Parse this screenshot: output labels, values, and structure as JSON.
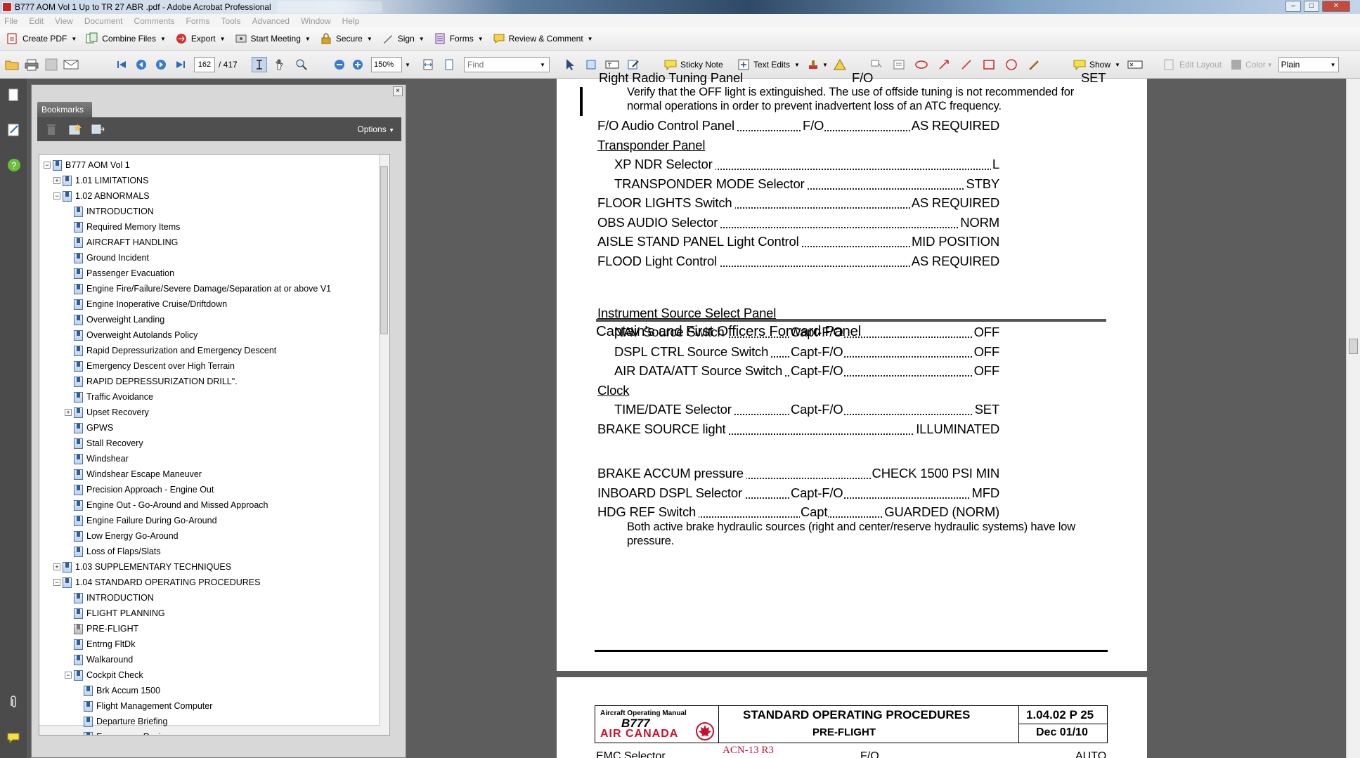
{
  "window": {
    "title": "B777 AOM Vol 1 Up to TR 27  ABR .pdf - Adobe Acrobat Professional"
  },
  "menu": [
    "File",
    "Edit",
    "View",
    "Document",
    "Comments",
    "Forms",
    "Tools",
    "Advanced",
    "Window",
    "Help"
  ],
  "toolbar1": {
    "create_pdf": "Create PDF",
    "combine_files": "Combine Files",
    "export": "Export",
    "start_meeting": "Start Meeting",
    "secure": "Secure",
    "sign": "Sign",
    "forms": "Forms",
    "review_comment": "Review & Comment"
  },
  "toolbar2": {
    "page_current": "162",
    "page_total": "/ 417",
    "zoom": "150%",
    "find_placeholder": "Find",
    "sticky_note": "Sticky Note",
    "text_edits": "Text Edits",
    "show": "Show",
    "edit_layout": "Edit Layout",
    "color": "Color",
    "plain": "Plain"
  },
  "bookmarks": {
    "tab_label": "Bookmarks",
    "options_label": "Options",
    "items": [
      {
        "label": "B777 AOM Vol 1",
        "level": 0,
        "exp": "minus"
      },
      {
        "label": "1.01 LIMITATIONS",
        "level": 1,
        "exp": "plus"
      },
      {
        "label": "1.02 ABNORMALS",
        "level": 1,
        "exp": "minus"
      },
      {
        "label": "INTRODUCTION",
        "level": 2,
        "exp": ""
      },
      {
        "label": "Required Memory Items",
        "level": 2,
        "exp": ""
      },
      {
        "label": "AIRCRAFT HANDLING",
        "level": 2,
        "exp": ""
      },
      {
        "label": "Ground Incident",
        "level": 2,
        "exp": ""
      },
      {
        "label": "Passenger Evacuation",
        "level": 2,
        "exp": ""
      },
      {
        "label": "Engine Fire/Failure/Severe Damage/Separation at or above V1",
        "level": 2,
        "exp": ""
      },
      {
        "label": "Engine Inoperative Cruise/Driftdown",
        "level": 2,
        "exp": ""
      },
      {
        "label": "Overweight Landing",
        "level": 2,
        "exp": ""
      },
      {
        "label": "Overweight Autolands Policy",
        "level": 2,
        "exp": ""
      },
      {
        "label": "Rapid Depressurization and Emergency Descent",
        "level": 2,
        "exp": ""
      },
      {
        "label": "Emergency Descent over High Terrain",
        "level": 2,
        "exp": ""
      },
      {
        "label": "RAPID DEPRESSURIZATION DRILL\".",
        "level": 2,
        "exp": ""
      },
      {
        "label": "Traffic Avoidance",
        "level": 2,
        "exp": ""
      },
      {
        "label": "Upset Recovery",
        "level": 2,
        "exp": "plus"
      },
      {
        "label": "GPWS",
        "level": 2,
        "exp": ""
      },
      {
        "label": "Stall Recovery",
        "level": 2,
        "exp": ""
      },
      {
        "label": "Windshear",
        "level": 2,
        "exp": ""
      },
      {
        "label": "Windshear Escape Maneuver",
        "level": 2,
        "exp": ""
      },
      {
        "label": "Precision Approach - Engine Out",
        "level": 2,
        "exp": ""
      },
      {
        "label": "Engine Out - Go-Around and Missed Approach",
        "level": 2,
        "exp": ""
      },
      {
        "label": "Engine Failure During Go-Around",
        "level": 2,
        "exp": ""
      },
      {
        "label": "Low Energy Go-Around",
        "level": 2,
        "exp": ""
      },
      {
        "label": "Loss of Flaps/Slats",
        "level": 2,
        "exp": ""
      },
      {
        "label": "1.03 SUPPLEMENTARY TECHNIQUES",
        "level": 1,
        "exp": "plus"
      },
      {
        "label": "1.04 STANDARD OPERATING PROCEDURES",
        "level": 1,
        "exp": "minus"
      },
      {
        "label": "INTRODUCTION",
        "level": 2,
        "exp": ""
      },
      {
        "label": "FLIGHT PLANNING",
        "level": 2,
        "exp": ""
      },
      {
        "label": "PRE-FLIGHT",
        "level": 2,
        "exp": "",
        "gray": true
      },
      {
        "label": "Entrng FltDk",
        "level": 2,
        "exp": ""
      },
      {
        "label": "Walkaround",
        "level": 2,
        "exp": ""
      },
      {
        "label": "Cockpit Check",
        "level": 2,
        "exp": "minus"
      },
      {
        "label": "Brk Accum 1500",
        "level": 3,
        "exp": ""
      },
      {
        "label": "Flight Management Computer",
        "level": 3,
        "exp": ""
      },
      {
        "label": "Departure Briefing",
        "level": 3,
        "exp": ""
      },
      {
        "label": "Emergency Review",
        "level": 3,
        "exp": ""
      }
    ]
  },
  "document": {
    "top_cut_left": "Right Radio Tuning Panel",
    "top_cut_mid": "F/O",
    "top_cut_right": "SET",
    "note1_line1": "Verify that the OFF light is extinguished.  The use of offside tuning is not recommended for",
    "note1_line2": "normal operations in order to prevent inadvertent loss of an ATC frequency.",
    "fo_audio": {
      "label": "F/O Audio Control Panel",
      "mid": "F/O",
      "value": "AS REQUIRED"
    },
    "transponder_heading": "Transponder Panel",
    "xpndr": {
      "label": "XP NDR Selector",
      "value": "L"
    },
    "xpndr_mode": {
      "label": "TRANSPONDER MODE Selector",
      "value": "STBY"
    },
    "floor_lights": {
      "label": "FLOOR LIGHTS Switch",
      "value": "AS REQUIRED"
    },
    "obs_audio": {
      "label": "OBS AUDIO Selector",
      "value": "NORM"
    },
    "aisle_stand": {
      "label": "AISLE STAND PANEL Light Control",
      "value": "MID POSITION"
    },
    "flood_light": {
      "label": "FLOOD Light Control",
      "value": "AS REQUIRED"
    },
    "section_title": "Captain’s and First Officers Forward Panel",
    "instrument_heading": "Instrument Source Select Panel",
    "nav_source": {
      "label": "NAV Source Switch",
      "mid": "Capt-F/O",
      "value": "OFF"
    },
    "dspl_ctrl": {
      "label": "DSPL CTRL Source Switch",
      "mid": "Capt-F/O",
      "value": "OFF"
    },
    "air_data": {
      "label": "AIR DATA/ATT Source Switch",
      "mid": "Capt-F/O",
      "value": "OFF"
    },
    "clock_heading": "Clock",
    "time_date": {
      "label": "TIME/DATE Selector",
      "mid": "Capt-F/O",
      "value": "SET"
    },
    "brake_source": {
      "label": "BRAKE SOURCE light",
      "value": "ILLUMINATED"
    },
    "brake_note_line1": "Both active brake hydraulic sources (right and center/reserve hydraulic systems) have low",
    "brake_note_line2": "pressure.",
    "brake_accum": {
      "label": "BRAKE ACCUM pressure",
      "value": "CHECK 1500 PSI MIN"
    },
    "inboard_dspl": {
      "label": "INBOARD DSPL Selector",
      "mid": "Capt-F/O",
      "value": "MFD"
    },
    "hdg_ref": {
      "label": "HDG REF Switch",
      "mid": "Capt",
      "value": "GUARDED (NORM)"
    }
  },
  "page2": {
    "manual_label": "Aircraft Operating Manual",
    "aircraft": "B777",
    "airline": "AIR CANADA",
    "title": "STANDARD OPERATING PROCEDURES",
    "subtitle": "PRE-FLIGHT",
    "page_ref": "1.04.02 P 25",
    "date": "Dec 01/10",
    "revision": "ACN-13 R3",
    "cut_left": "EMC Selector",
    "cut_mid": "F/O",
    "cut_right": "AUTO"
  },
  "colors": {
    "accent_red": "#c8102e",
    "doc_bg": "#5d5d5d"
  }
}
